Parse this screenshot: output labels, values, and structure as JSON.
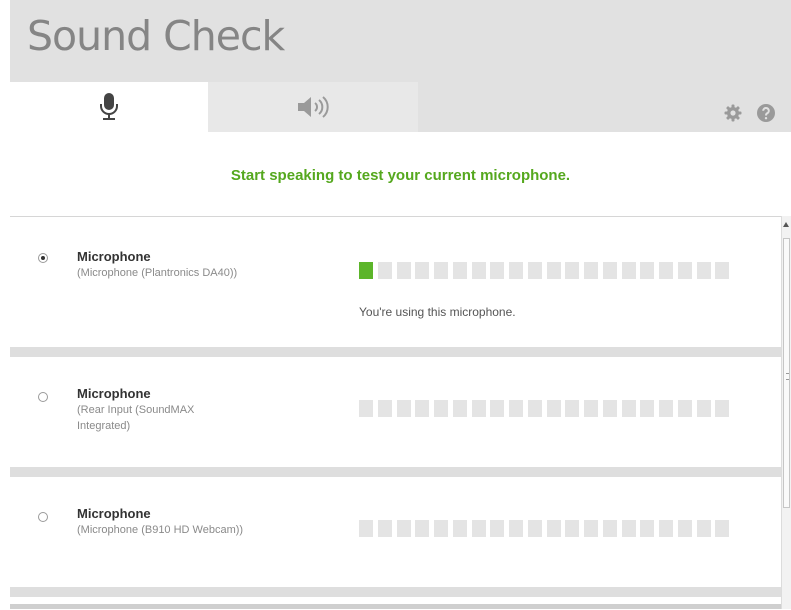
{
  "app": {
    "title": "Sound Check"
  },
  "tabs": [
    {
      "name": "microphone",
      "icon": "microphone-icon",
      "selected": true
    },
    {
      "name": "speaker",
      "icon": "speaker-icon",
      "selected": false
    }
  ],
  "toolbar": {
    "settings_icon": "gear-icon",
    "help_icon": "help-icon"
  },
  "instruction": "Start speaking to test your current microphone.",
  "colors": {
    "accent": "#55a81e",
    "meter_lit": "#5cb52a",
    "meter_unlit": "#e4e4e4",
    "header_bg": "#e1e1e1"
  },
  "devices": [
    {
      "name": "Microphone",
      "description": "(Microphone (Plantronics DA40))",
      "selected": true,
      "level": 1,
      "level_max": 20,
      "status": "You're using this microphone."
    },
    {
      "name": "Microphone",
      "description": "(Rear Input (SoundMAX Integrated)",
      "selected": false,
      "level": 0,
      "level_max": 20,
      "status": ""
    },
    {
      "name": "Microphone",
      "description": "(Microphone (B910 HD Webcam))",
      "selected": false,
      "level": 0,
      "level_max": 20,
      "status": ""
    }
  ]
}
